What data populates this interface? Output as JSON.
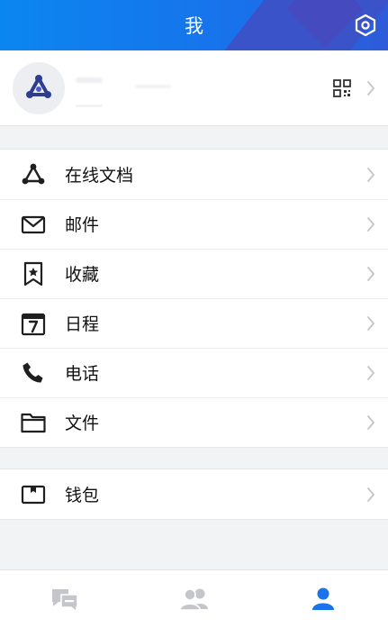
{
  "header": {
    "title": "我",
    "settings_icon": "hexagon-settings-icon"
  },
  "profile": {
    "avatar_icon": "docs-logo-icon",
    "qr_icon": "qr-code-icon"
  },
  "menu_group_1": [
    {
      "label": "在线文档",
      "icon": "online-docs-icon"
    },
    {
      "label": "邮件",
      "icon": "mail-icon"
    },
    {
      "label": "收藏",
      "icon": "bookmark-star-icon"
    },
    {
      "label": "日程",
      "icon": "calendar-icon"
    },
    {
      "label": "电话",
      "icon": "phone-icon"
    },
    {
      "label": "文件",
      "icon": "folder-icon"
    }
  ],
  "menu_group_2": [
    {
      "label": "钱包",
      "icon": "wallet-icon"
    }
  ],
  "tabs": [
    {
      "icon": "messages-icon",
      "active": false
    },
    {
      "icon": "contacts-icon",
      "active": false
    },
    {
      "icon": "me-icon",
      "active": true
    }
  ],
  "colors": {
    "header_blue": "#0b86f0",
    "accent_active": "#1a73e8",
    "icon_inactive": "#c4c6cc",
    "icon_dark": "#1f1f1f",
    "chevron": "#c5c5c5"
  }
}
